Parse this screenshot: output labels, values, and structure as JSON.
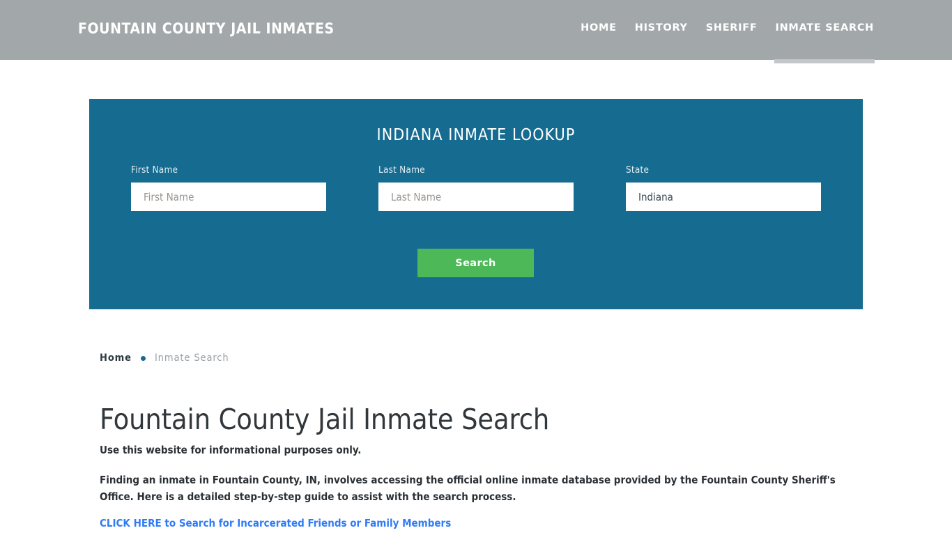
{
  "header": {
    "brand": "FOUNTAIN COUNTY JAIL INMATES",
    "brand_color": "#ffffff",
    "background_color": "#a2a7aa",
    "nav": [
      {
        "label": "HOME",
        "active": false
      },
      {
        "label": "HISTORY",
        "active": false
      },
      {
        "label": "SHERIFF",
        "active": false
      },
      {
        "label": "INMATE SEARCH",
        "active": true
      }
    ]
  },
  "lookup": {
    "title": "INDIANA INMATE LOOKUP",
    "panel_color": "#166b90",
    "fields": {
      "first_name": {
        "label": "First Name",
        "placeholder": "First Name",
        "value": ""
      },
      "last_name": {
        "label": "Last Name",
        "placeholder": "Last Name",
        "value": ""
      },
      "state": {
        "label": "State",
        "placeholder": "State",
        "value": "Indiana"
      }
    },
    "search_button": {
      "label": "Search",
      "color": "#4cb857"
    }
  },
  "breadcrumb": {
    "home": "Home",
    "separator": "•",
    "current": "Inmate Search"
  },
  "content": {
    "title": "Fountain County Jail Inmate Search",
    "lede": "Use this website for informational purposes only.",
    "paragraph": "Finding an inmate in Fountain County, IN, involves accessing the official online inmate database provided by the Fountain County Sheriff's Office. Here is a detailed step-by-step guide to assist with the search process.",
    "cta_link": "CLICK HERE to Search for Incarcerated Friends or Family Members",
    "cta_link_color": "#2f7bf6"
  }
}
